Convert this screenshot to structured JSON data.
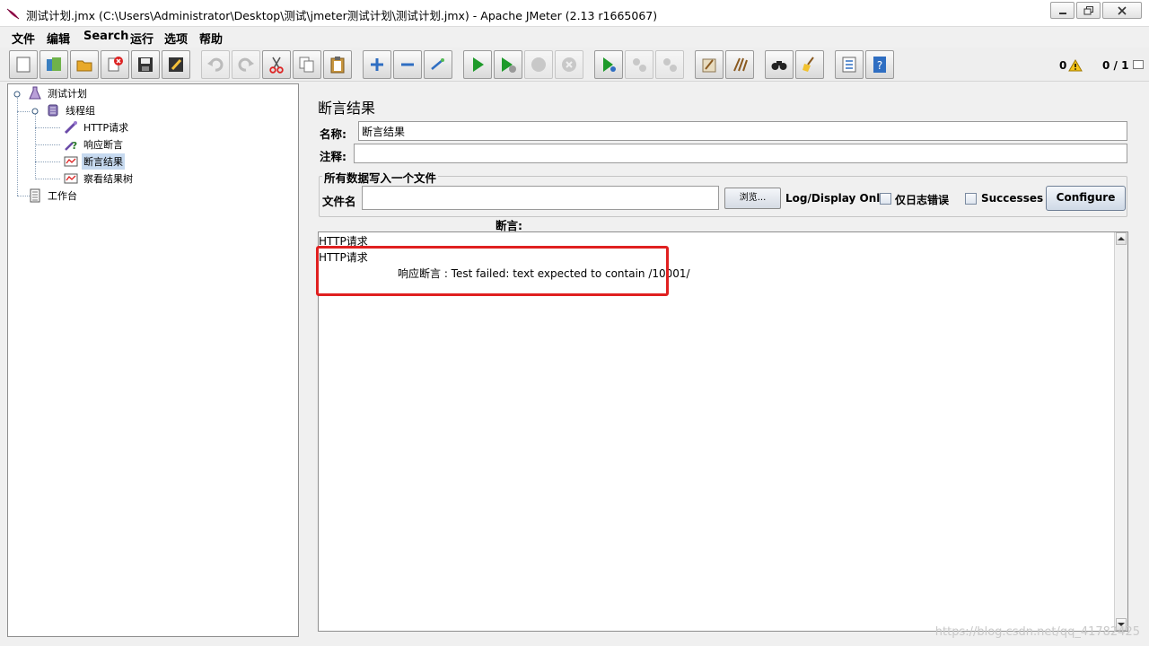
{
  "window": {
    "title": "测试计划.jmx (C:\\Users\\Administrator\\Desktop\\测试\\jmeter测试计划\\测试计划.jmx) - Apache JMeter (2.13 r1665067)"
  },
  "menu": {
    "items": [
      "文件",
      "编辑",
      "Search",
      "运行",
      "选项",
      "帮助"
    ]
  },
  "toolbar": {
    "warning_count": "0",
    "thread_ratio": "0 / 1"
  },
  "tree": {
    "nodes": [
      {
        "label": "测试计划",
        "icon": "test-plan-icon"
      },
      {
        "label": "线程组",
        "icon": "thread-group-icon"
      },
      {
        "label": "HTTP请求",
        "icon": "http-sampler-icon"
      },
      {
        "label": "响应断言",
        "icon": "assertion-icon"
      },
      {
        "label": "断言结果",
        "icon": "listener-icon"
      },
      {
        "label": "察看结果树",
        "icon": "listener-icon"
      },
      {
        "label": "工作台",
        "icon": "workbench-icon"
      }
    ]
  },
  "panel": {
    "title": "断言结果",
    "name_label": "名称:",
    "name_value": "断言结果",
    "comment_label": "注释:",
    "comment_value": "",
    "file_section_legend": "所有数据写入一个文件",
    "filename_label": "文件名",
    "filename_value": "",
    "browse_label": "浏览...",
    "log_display_label": "Log/Display Only:",
    "errors_only_label": "仅日志错误",
    "successes_label": "Successes",
    "configure_label": "Configure",
    "assertion_header": "断言:"
  },
  "results": {
    "lines": [
      "HTTP请求",
      "HTTP请求",
      "响应断言 : Test failed: text expected to contain /10001/"
    ]
  },
  "watermark": "https://blog.csdn.net/qq_41782425",
  "colors": {
    "highlight": "#e02020",
    "selection": "#c6d9ef"
  }
}
